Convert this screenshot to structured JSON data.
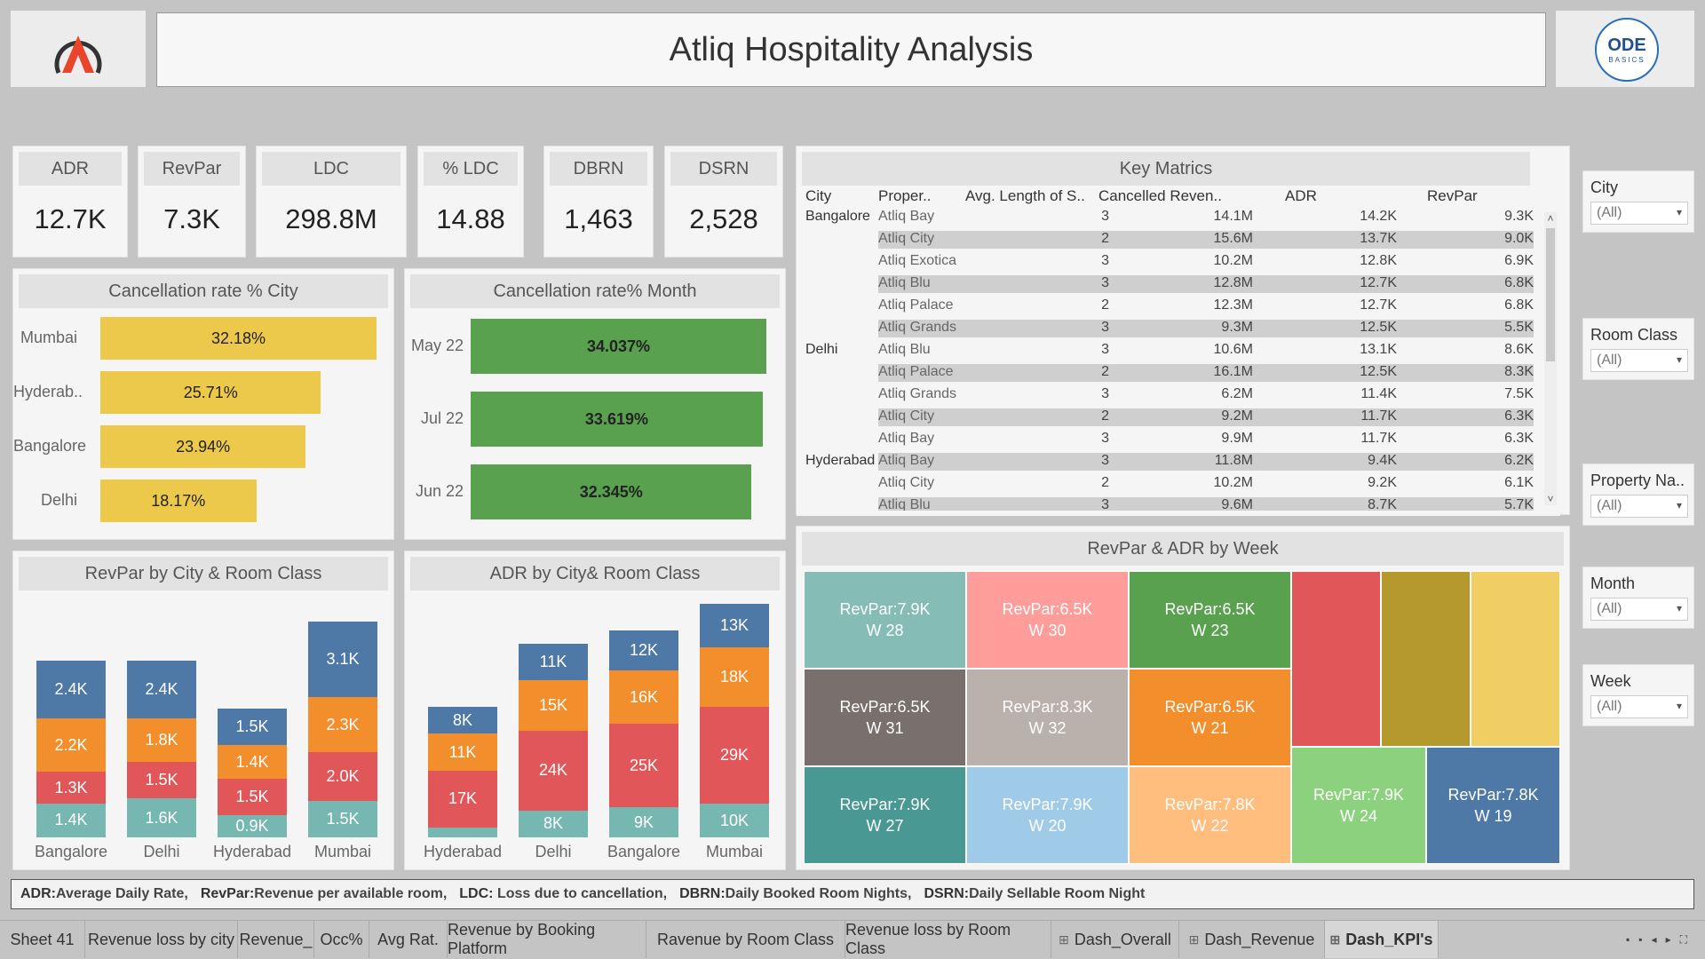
{
  "header": {
    "title": "Atliq Hospitality Analysis",
    "logo_right_text": "ODE",
    "logo_right_sub": "BASICS"
  },
  "kpis": [
    {
      "label": "ADR",
      "value": "12.7K"
    },
    {
      "label": "RevPar",
      "value": "7.3K"
    },
    {
      "label": "LDC",
      "value": "298.8M"
    },
    {
      "label": "% LDC",
      "value": "14.88"
    },
    {
      "label": "DBRN",
      "value": "1,463"
    },
    {
      "label": "DSRN",
      "value": "2,528"
    }
  ],
  "cancel_city": {
    "title": "Cancellation rate % City",
    "items": [
      {
        "label": "Mumbai",
        "value": 32.18,
        "text": "32.18%"
      },
      {
        "label": "Hyderab..",
        "value": 25.71,
        "text": "25.71%"
      },
      {
        "label": "Bangalore",
        "value": 23.94,
        "text": "23.94%"
      },
      {
        "label": "Delhi",
        "value": 18.17,
        "text": "18.17%"
      }
    ],
    "color": "#ecc94b"
  },
  "cancel_month": {
    "title": "Cancellation rate% Month",
    "items": [
      {
        "label": "May 22",
        "value": 34.037,
        "text": "34.037%"
      },
      {
        "label": "Jul 22",
        "value": 33.619,
        "text": "33.619%"
      },
      {
        "label": "Jun 22",
        "value": 32.345,
        "text": "32.345%"
      }
    ],
    "color": "#59a14f"
  },
  "revpar_chart": {
    "title": "RevPar by City & Room Class",
    "categories": [
      "Bangalore",
      "Delhi",
      "Hyderabad",
      "Mumbai"
    ],
    "colors": [
      "#76b7b2",
      "#e15759",
      "#f28e2b",
      "#4e79a7"
    ],
    "series": [
      {
        "values": [
          1.4,
          1.6,
          0.9,
          1.5
        ],
        "labels": [
          "1.4K",
          "1.6K",
          "0.9K",
          "1.5K"
        ]
      },
      {
        "values": [
          1.3,
          1.5,
          1.5,
          2.0
        ],
        "labels": [
          "1.3K",
          "1.5K",
          "1.5K",
          "2.0K"
        ]
      },
      {
        "values": [
          2.2,
          1.8,
          1.4,
          2.3
        ],
        "labels": [
          "2.2K",
          "1.8K",
          "1.4K",
          "2.3K"
        ]
      },
      {
        "values": [
          2.4,
          2.4,
          1.5,
          3.1
        ],
        "labels": [
          "2.4K",
          "2.4K",
          "1.5K",
          "3.1K"
        ]
      }
    ]
  },
  "adr_chart": {
    "title": "ADR by City& Room Class",
    "categories": [
      "Hyderabad",
      "Delhi",
      "Bangalore",
      "Mumbai"
    ],
    "colors": [
      "#76b7b2",
      "#e15759",
      "#f28e2b",
      "#4e79a7"
    ],
    "series": [
      {
        "values": [
          3,
          8,
          9,
          10
        ],
        "labels": [
          "",
          "8K",
          "9K",
          "10K"
        ]
      },
      {
        "values": [
          17,
          24,
          25,
          29
        ],
        "labels": [
          "17K",
          "24K",
          "25K",
          "29K"
        ]
      },
      {
        "values": [
          11,
          15,
          16,
          18
        ],
        "labels": [
          "11K",
          "15K",
          "16K",
          "18K"
        ]
      },
      {
        "values": [
          8,
          11,
          12,
          13
        ],
        "labels": [
          "8K",
          "11K",
          "12K",
          "13K"
        ]
      }
    ]
  },
  "key_matrics": {
    "title": "Key Matrics",
    "headers": [
      "City",
      "Proper..",
      "Avg. Length of S..",
      "Cancelled Reven..",
      "ADR",
      "RevPar"
    ],
    "rows": [
      [
        "Bangalore",
        "Atliq Bay",
        "3",
        "14.1M",
        "14.2K",
        "9.3K"
      ],
      [
        "",
        "Atliq City",
        "2",
        "15.6M",
        "13.7K",
        "9.0K"
      ],
      [
        "",
        "Atliq Exotica",
        "3",
        "10.2M",
        "12.8K",
        "6.9K"
      ],
      [
        "",
        "Atliq Blu",
        "3",
        "12.8M",
        "12.7K",
        "6.8K"
      ],
      [
        "",
        "Atliq Palace",
        "2",
        "12.3M",
        "12.7K",
        "6.8K"
      ],
      [
        "",
        "Atliq Grands",
        "3",
        "9.3M",
        "12.5K",
        "5.5K"
      ],
      [
        "Delhi",
        "Atliq Blu",
        "3",
        "10.6M",
        "13.1K",
        "8.6K"
      ],
      [
        "",
        "Atliq Palace",
        "2",
        "16.1M",
        "12.5K",
        "8.3K"
      ],
      [
        "",
        "Atliq Grands",
        "3",
        "6.2M",
        "11.4K",
        "7.5K"
      ],
      [
        "",
        "Atliq City",
        "2",
        "9.2M",
        "11.7K",
        "6.3K"
      ],
      [
        "",
        "Atliq Bay",
        "3",
        "9.9M",
        "11.7K",
        "6.3K"
      ],
      [
        "Hyderabad",
        "Atliq Bay",
        "3",
        "11.8M",
        "9.4K",
        "6.2K"
      ],
      [
        "",
        "Atliq City",
        "2",
        "10.2M",
        "9.2K",
        "6.1K"
      ],
      [
        "",
        "Atliq Blu",
        "3",
        "9.6M",
        "8.7K",
        "5.7K"
      ]
    ]
  },
  "treemap": {
    "title": "RevPar & ADR by Week",
    "tiles": [
      {
        "l1": "RevPar:7.9K",
        "l2": "W 28",
        "color": "#86bcb6"
      },
      {
        "l1": "RevPar:6.5K",
        "l2": "W 30",
        "color": "#ff9d9a"
      },
      {
        "l1": "RevPar:6.5K",
        "l2": "W 23",
        "color": "#59a14f"
      },
      {
        "l1": "",
        "l2": "",
        "color": "#e15759"
      },
      {
        "l1": "",
        "l2": "",
        "color": "#b6992d"
      },
      {
        "l1": "",
        "l2": "",
        "color": "#f1ce63"
      },
      {
        "l1": "RevPar:6.5K",
        "l2": "W 31",
        "color": "#79706e"
      },
      {
        "l1": "RevPar:8.3K",
        "l2": "W 32",
        "color": "#bab0ac"
      },
      {
        "l1": "RevPar:6.5K",
        "l2": "W 21",
        "color": "#f28e2b"
      },
      {
        "l1": "RevPar:7.9K",
        "l2": "W 27",
        "color": "#499894"
      },
      {
        "l1": "RevPar:7.9K",
        "l2": "W 20",
        "color": "#a0cbe8"
      },
      {
        "l1": "RevPar:7.8K",
        "l2": "W 22",
        "color": "#ffbe7d"
      },
      {
        "l1": "RevPar:7.9K",
        "l2": "W 24",
        "color": "#8cd17d"
      },
      {
        "l1": "RevPar:7.8K",
        "l2": "W 19",
        "color": "#4e79a7"
      }
    ]
  },
  "filters": [
    {
      "label": "City",
      "value": "(All)"
    },
    {
      "label": "Room Class",
      "value": "(All)"
    },
    {
      "label": "Property Na..",
      "value": "(All)"
    },
    {
      "label": "Month",
      "value": "(All)"
    },
    {
      "label": "Week",
      "value": "(All)"
    }
  ],
  "legend_bar": [
    {
      "key": "ADR:",
      "desc": "Average Daily Rate,"
    },
    {
      "key": "RevPar:",
      "desc": "Revenue per available room,"
    },
    {
      "key": "LDC:",
      "desc": " Loss due to cancellation,"
    },
    {
      "key": "DBRN:",
      "desc": "Daily Booked Room Nights,"
    },
    {
      "key": "DSRN:",
      "desc": "Daily Sellable Room Night"
    }
  ],
  "tabs": [
    {
      "label": "Sheet 41",
      "icon": ""
    },
    {
      "label": "Revenue loss by city",
      "icon": ""
    },
    {
      "label": "Revenue_",
      "icon": ""
    },
    {
      "label": "Occ%",
      "icon": ""
    },
    {
      "label": "Avg Rat.",
      "icon": ""
    },
    {
      "label": "Revenue by Booking Platform",
      "icon": ""
    },
    {
      "label": "Ravenue by Room Class",
      "icon": ""
    },
    {
      "label": "Revenue loss by Room Class",
      "icon": ""
    },
    {
      "label": "Dash_Overall",
      "icon": "⊞"
    },
    {
      "label": "Dash_Revenue",
      "icon": "⊞"
    },
    {
      "label": "Dash_KPI's",
      "icon": "⊞",
      "active": true
    }
  ],
  "chart_data": [
    {
      "type": "bar",
      "title": "Cancellation rate % City",
      "categories": [
        "Mumbai",
        "Hyderab..",
        "Bangalore",
        "Delhi"
      ],
      "values": [
        32.18,
        25.71,
        23.94,
        18.17
      ]
    },
    {
      "type": "bar",
      "title": "Cancellation rate% Month",
      "categories": [
        "May 22",
        "Jul 22",
        "Jun 22"
      ],
      "values": [
        34.037,
        33.619,
        32.345
      ]
    },
    {
      "type": "bar",
      "title": "RevPar by City & Room Class",
      "categories": [
        "Bangalore",
        "Delhi",
        "Hyderabad",
        "Mumbai"
      ],
      "series": [
        {
          "values": [
            1.4,
            1.6,
            0.9,
            1.5
          ]
        },
        {
          "values": [
            1.3,
            1.5,
            1.5,
            2.0
          ]
        },
        {
          "values": [
            2.2,
            1.8,
            1.4,
            2.3
          ]
        },
        {
          "values": [
            2.4,
            2.4,
            1.5,
            3.1
          ]
        }
      ]
    },
    {
      "type": "bar",
      "title": "ADR by City& Room Class",
      "categories": [
        "Hyderabad",
        "Delhi",
        "Bangalore",
        "Mumbai"
      ],
      "series": [
        {
          "values": [
            3,
            8,
            9,
            10
          ]
        },
        {
          "values": [
            17,
            24,
            25,
            29
          ]
        },
        {
          "values": [
            11,
            15,
            16,
            18
          ]
        },
        {
          "values": [
            8,
            11,
            12,
            13
          ]
        }
      ]
    }
  ]
}
